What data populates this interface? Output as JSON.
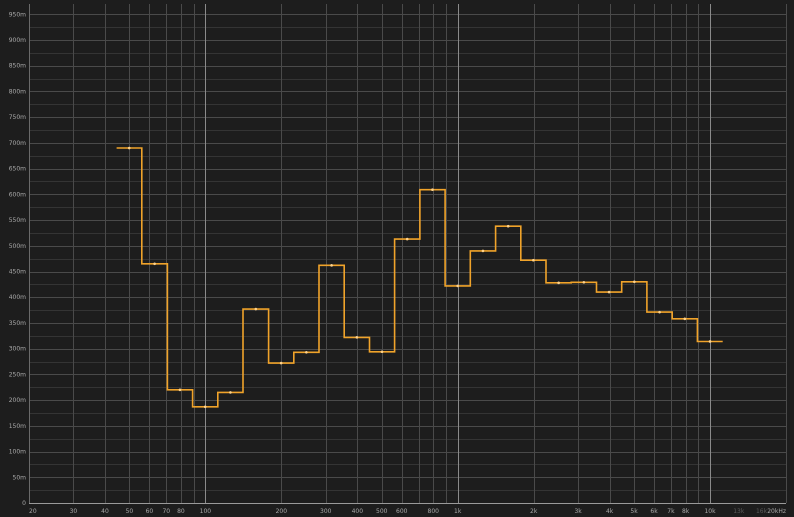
{
  "chart_data": {
    "type": "line",
    "step": "post",
    "x_scale": "log",
    "xlim": [
      20,
      20000
    ],
    "ylim": [
      0,
      0.97
    ],
    "title": "",
    "xlabel": "",
    "ylabel": "",
    "grid": true,
    "background": "#1d1d1d",
    "series_color": "#f0a32a",
    "grid_colors": {
      "minor": "#343434",
      "major": "#4a4a4a",
      "decade": "#8a8a8a"
    },
    "y_ticks": [
      {
        "value": 0,
        "label": "0"
      },
      {
        "value": 0.05,
        "label": "50m"
      },
      {
        "value": 0.1,
        "label": "100m"
      },
      {
        "value": 0.15,
        "label": "150m"
      },
      {
        "value": 0.2,
        "label": "200m"
      },
      {
        "value": 0.25,
        "label": "250m"
      },
      {
        "value": 0.3,
        "label": "300m"
      },
      {
        "value": 0.35,
        "label": "350m"
      },
      {
        "value": 0.4,
        "label": "400m"
      },
      {
        "value": 0.45,
        "label": "450m"
      },
      {
        "value": 0.5,
        "label": "500m"
      },
      {
        "value": 0.55,
        "label": "550m"
      },
      {
        "value": 0.6,
        "label": "600m"
      },
      {
        "value": 0.65,
        "label": "650m"
      },
      {
        "value": 0.7,
        "label": "700m"
      },
      {
        "value": 0.75,
        "label": "750m"
      },
      {
        "value": 0.8,
        "label": "800m"
      },
      {
        "value": 0.85,
        "label": "850m"
      },
      {
        "value": 0.9,
        "label": "900m"
      },
      {
        "value": 0.95,
        "label": "950m"
      }
    ],
    "x_ticks": [
      {
        "value": 20,
        "label": "20"
      },
      {
        "value": 30,
        "label": "30"
      },
      {
        "value": 40,
        "label": "40"
      },
      {
        "value": 50,
        "label": "50"
      },
      {
        "value": 60,
        "label": "60"
      },
      {
        "value": 70,
        "label": "70"
      },
      {
        "value": 80,
        "label": "80"
      },
      {
        "value": 100,
        "label": "100"
      },
      {
        "value": 200,
        "label": "200"
      },
      {
        "value": 300,
        "label": "300"
      },
      {
        "value": 400,
        "label": "400"
      },
      {
        "value": 500,
        "label": "500"
      },
      {
        "value": 600,
        "label": "600"
      },
      {
        "value": 800,
        "label": "800"
      },
      {
        "value": 1000,
        "label": "1k"
      },
      {
        "value": 2000,
        "label": "2k"
      },
      {
        "value": 3000,
        "label": "3k"
      },
      {
        "value": 4000,
        "label": "4k"
      },
      {
        "value": 5000,
        "label": "5k"
      },
      {
        "value": 6000,
        "label": "6k"
      },
      {
        "value": 7000,
        "label": "7k"
      },
      {
        "value": 8000,
        "label": "8k"
      },
      {
        "value": 10000,
        "label": "10k"
      },
      {
        "value": 13000,
        "label": "13k",
        "dim": true
      },
      {
        "value": 16000,
        "label": "16k",
        "dim": true
      },
      {
        "value": 20000,
        "label": "20kHz"
      }
    ],
    "bands": [
      {
        "x_start": 44.5,
        "x_end": 56,
        "value": 0.69
      },
      {
        "x_start": 56,
        "x_end": 70.7,
        "value": 0.465
      },
      {
        "x_start": 70.7,
        "x_end": 89,
        "value": 0.22
      },
      {
        "x_start": 89,
        "x_end": 112,
        "value": 0.187
      },
      {
        "x_start": 112,
        "x_end": 141,
        "value": 0.215
      },
      {
        "x_start": 141,
        "x_end": 178,
        "value": 0.377
      },
      {
        "x_start": 178,
        "x_end": 224,
        "value": 0.272
      },
      {
        "x_start": 224,
        "x_end": 282,
        "value": 0.293
      },
      {
        "x_start": 282,
        "x_end": 355,
        "value": 0.462
      },
      {
        "x_start": 355,
        "x_end": 447,
        "value": 0.322
      },
      {
        "x_start": 447,
        "x_end": 562,
        "value": 0.294
      },
      {
        "x_start": 562,
        "x_end": 708,
        "value": 0.513
      },
      {
        "x_start": 708,
        "x_end": 891,
        "value": 0.609
      },
      {
        "x_start": 891,
        "x_end": 1122,
        "value": 0.422
      },
      {
        "x_start": 1122,
        "x_end": 1413,
        "value": 0.49
      },
      {
        "x_start": 1413,
        "x_end": 1778,
        "value": 0.538
      },
      {
        "x_start": 1778,
        "x_end": 2239,
        "value": 0.472
      },
      {
        "x_start": 2239,
        "x_end": 2818,
        "value": 0.428
      },
      {
        "x_start": 2818,
        "x_end": 3548,
        "value": 0.429
      },
      {
        "x_start": 3548,
        "x_end": 4467,
        "value": 0.41
      },
      {
        "x_start": 4467,
        "x_end": 5623,
        "value": 0.43
      },
      {
        "x_start": 5623,
        "x_end": 7079,
        "value": 0.371
      },
      {
        "x_start": 7079,
        "x_end": 8913,
        "value": 0.358
      },
      {
        "x_start": 8913,
        "x_end": 11220,
        "value": 0.314
      }
    ]
  }
}
